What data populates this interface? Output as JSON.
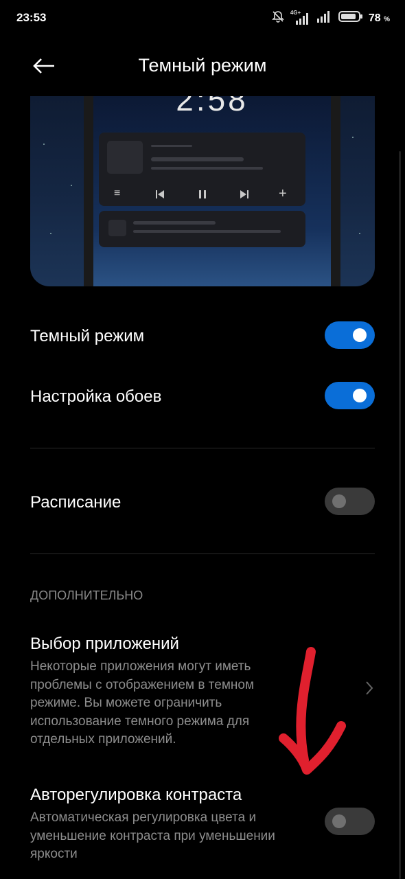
{
  "status_bar": {
    "time": "23:53",
    "network": "4G+",
    "battery_percent": "78",
    "battery_unit": "%",
    "icons": [
      "bell-off-icon",
      "signal-icon",
      "signal-icon",
      "battery-icon"
    ]
  },
  "header": {
    "title": "Темный режим",
    "back_icon": "arrow-left-icon"
  },
  "preview": {
    "clock": "2:58"
  },
  "settings": {
    "dark_mode": {
      "label": "Темный режим",
      "enabled": true
    },
    "wallpaper": {
      "label": "Настройка обоев",
      "enabled": true
    },
    "schedule": {
      "label": "Расписание",
      "enabled": false
    }
  },
  "additional": {
    "heading": "ДОПОЛНИТЕЛЬНО",
    "app_selection": {
      "title": "Выбор приложений",
      "description": "Некоторые приложения могут иметь проблемы с отображением в темном режиме. Вы можете ограничить использование темного режима для отдельных приложений.",
      "icon": "chevron-right-icon"
    },
    "auto_contrast": {
      "title": "Авторегулировка контраста",
      "description": "Автоматическая регулировка цвета и уменьшение контраста при уменьшении яркости",
      "enabled": false
    }
  },
  "colors": {
    "accent": "#0a6ed8",
    "annotation": "#e0202e"
  }
}
